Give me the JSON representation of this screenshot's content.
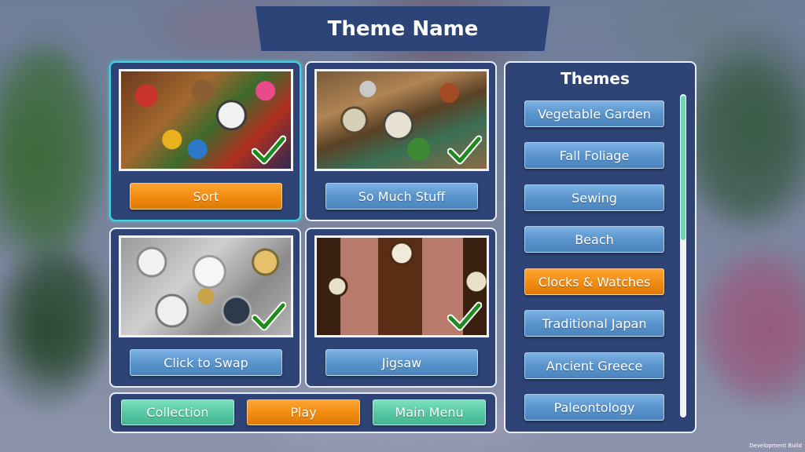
{
  "title": "Theme Name",
  "modes": [
    {
      "label": "Sort",
      "selected": true,
      "completed": true
    },
    {
      "label": "So Much Stuff",
      "selected": false,
      "completed": true
    },
    {
      "label": "Click to Swap",
      "selected": false,
      "completed": true
    },
    {
      "label": "Jigsaw",
      "selected": false,
      "completed": true
    }
  ],
  "bottom_bar": {
    "collection_label": "Collection",
    "play_label": "Play",
    "main_menu_label": "Main Menu"
  },
  "themes": {
    "heading": "Themes",
    "items": [
      {
        "label": "Vegetable Garden",
        "selected": false
      },
      {
        "label": "Fall Foliage",
        "selected": false
      },
      {
        "label": "Sewing",
        "selected": false
      },
      {
        "label": "Beach",
        "selected": false
      },
      {
        "label": "Clocks & Watches",
        "selected": true
      },
      {
        "label": "Traditional Japan",
        "selected": false
      },
      {
        "label": "Ancient Greece",
        "selected": false
      },
      {
        "label": "Paleontology",
        "selected": false
      }
    ]
  },
  "footer": {
    "dev_build": "Development Build"
  },
  "colors": {
    "panel": "#2e4476",
    "selected_outline": "#3fd6e6",
    "button_blue": "#5a94cc",
    "button_orange": "#f18b10",
    "button_teal": "#55c7a2",
    "check_green": "#1f8a1f"
  }
}
